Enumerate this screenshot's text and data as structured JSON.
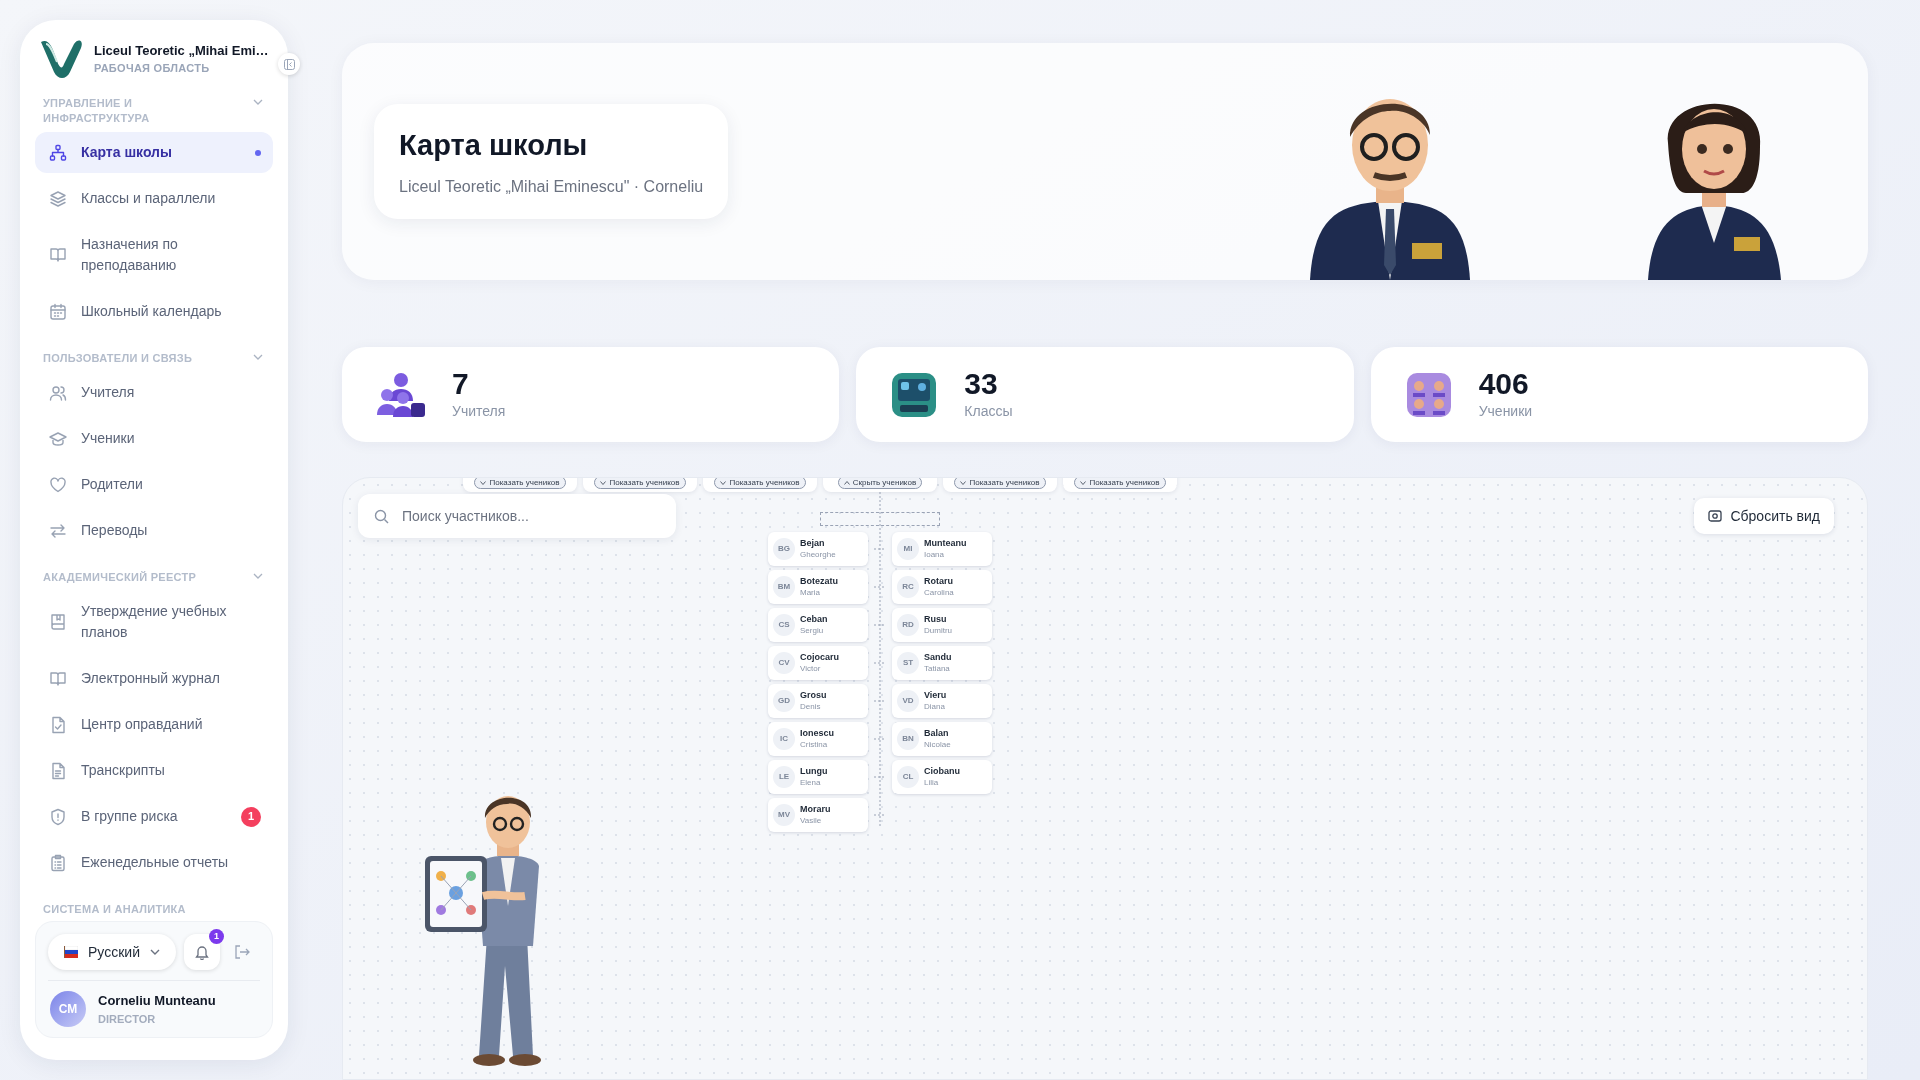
{
  "sidebar": {
    "workspace_name": "Liceul Teoretic „Mihai Emi…",
    "workspace_label": "РАБОЧАЯ ОБЛАСТЬ",
    "sections": [
      {
        "title": "УПРАВЛЕНИЕ И ИНФРАСТРУКТУРА",
        "items": [
          {
            "label": "Карта школы",
            "selected": true
          },
          {
            "label": "Классы и параллели",
            "selected": false
          },
          {
            "label": "Назначения по преподаванию",
            "selected": false
          },
          {
            "label": "Школьный календарь",
            "selected": false
          }
        ]
      },
      {
        "title": "ПОЛЬЗОВАТЕЛИ И СВЯЗЬ",
        "items": [
          {
            "label": "Учителя",
            "selected": false
          },
          {
            "label": "Ученики",
            "selected": false
          },
          {
            "label": "Родители",
            "selected": false
          },
          {
            "label": "Переводы",
            "selected": false
          }
        ]
      },
      {
        "title": "АКАДЕМИЧЕСКИЙ РЕЕСТР",
        "items": [
          {
            "label": "Утверждение учебных планов",
            "selected": false
          },
          {
            "label": "Электронный журнал",
            "selected": false
          },
          {
            "label": "Центр оправданий",
            "selected": false
          },
          {
            "label": "Транскрипты",
            "selected": false
          },
          {
            "label": "В группе риска",
            "selected": false,
            "badge": "1"
          },
          {
            "label": "Еженедельные отчеты",
            "selected": false
          }
        ]
      },
      {
        "title": "СИСТЕМА И АНАЛИТИКА"
      }
    ],
    "language": "Русский",
    "notification_count": "1",
    "user": {
      "initials": "CM",
      "name": "Corneliu Munteanu",
      "role": "DIRECTOR"
    }
  },
  "hero": {
    "title": "Карта школы",
    "subtitle": "Liceul Teoretic „Mihai Eminescu\" · Corneliu"
  },
  "stats": [
    {
      "value": "7",
      "label": "Учителя"
    },
    {
      "value": "33",
      "label": "Классы"
    },
    {
      "value": "406",
      "label": "Ученики"
    }
  ],
  "map": {
    "search_placeholder": "Поиск участников...",
    "reset_button": "Сбросить вид",
    "classes": [
      {
        "button": "Показать учеников",
        "expanded": false
      },
      {
        "button": "Показать учеников",
        "expanded": false
      },
      {
        "button": "Показать учеников",
        "expanded": false
      },
      {
        "button": "Скрыть учеников",
        "expanded": true,
        "student_columns": [
          {
            "students": [
              {
                "initials": "BG",
                "last_name": "Bejan",
                "first_name": "Gheorghe"
              },
              {
                "initials": "BM",
                "last_name": "Botezatu",
                "first_name": "Maria"
              },
              {
                "initials": "CS",
                "last_name": "Ceban",
                "first_name": "Sergiu"
              },
              {
                "initials": "CV",
                "last_name": "Cojocaru",
                "first_name": "Victor"
              },
              {
                "initials": "GD",
                "last_name": "Grosu",
                "first_name": "Denis"
              },
              {
                "initials": "IC",
                "last_name": "Ionescu",
                "first_name": "Cristina"
              },
              {
                "initials": "LE",
                "last_name": "Lungu",
                "first_name": "Elena"
              },
              {
                "initials": "MV",
                "last_name": "Moraru",
                "first_name": "Vasile"
              }
            ]
          },
          {
            "students": [
              {
                "initials": "MI",
                "last_name": "Munteanu",
                "first_name": "Ioana"
              },
              {
                "initials": "RC",
                "last_name": "Rotaru",
                "first_name": "Carolina"
              },
              {
                "initials": "RD",
                "last_name": "Rusu",
                "first_name": "Dumitru"
              },
              {
                "initials": "ST",
                "last_name": "Sandu",
                "first_name": "Tatiana"
              },
              {
                "initials": "VD",
                "last_name": "Vieru",
                "first_name": "Diana"
              },
              {
                "initials": "BN",
                "last_name": "Balan",
                "first_name": "Nicolae"
              },
              {
                "initials": "CL",
                "last_name": "Ciobanu",
                "first_name": "Lilia"
              }
            ]
          }
        ]
      },
      {
        "button": "Показать учеников",
        "expanded": false
      },
      {
        "button": "Показать учеников",
        "expanded": false
      }
    ]
  }
}
